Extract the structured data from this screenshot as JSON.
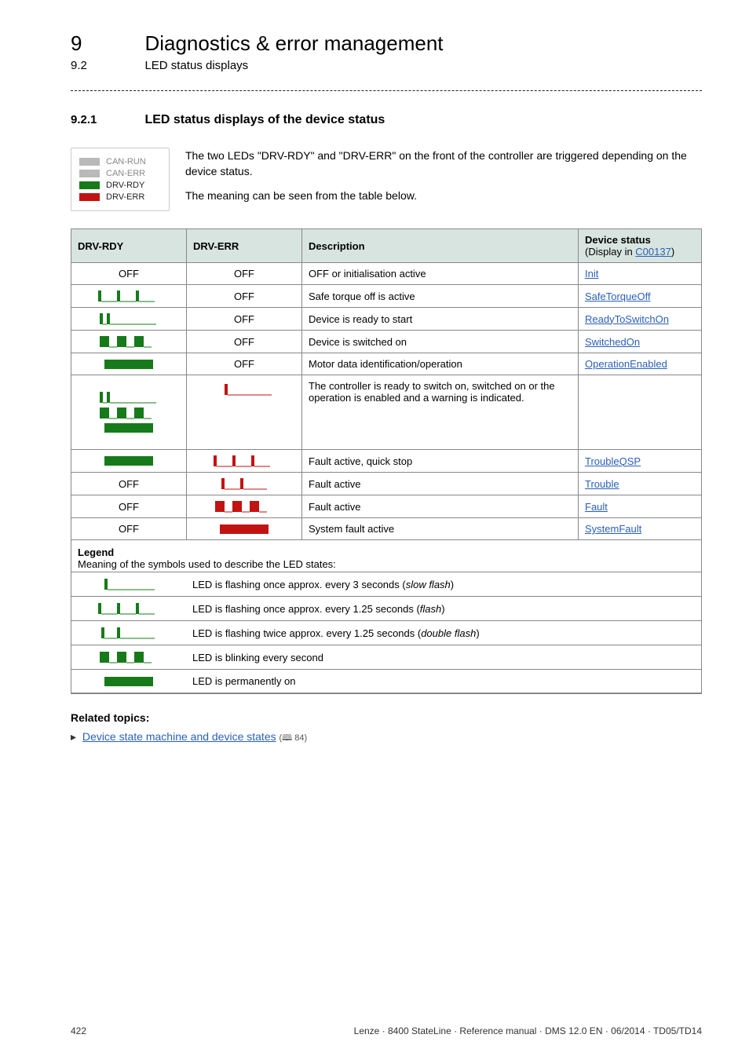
{
  "header": {
    "chapter_num": "9",
    "chapter_title": "Diagnostics & error management",
    "section_num": "9.2",
    "section_title": "LED status displays"
  },
  "sec921": {
    "num": "9.2.1",
    "title": "LED status displays of the device status"
  },
  "legend_box": {
    "items": [
      {
        "color": "grey",
        "label": "CAN-RUN"
      },
      {
        "color": "grey",
        "label": "CAN-ERR"
      },
      {
        "color": "green",
        "label": "DRV-RDY"
      },
      {
        "color": "red",
        "label": "DRV-ERR"
      }
    ]
  },
  "intro": {
    "p1": "The two LEDs \"DRV-RDY\" and \"DRV-ERR\" on the front of the controller are triggered depending on the device status.",
    "p2": "The meaning can be seen from the table below."
  },
  "table": {
    "headers": {
      "c1": "DRV-RDY",
      "c2": "DRV-ERR",
      "c3": "Description",
      "c4": "Device status",
      "c4sub": "(Display in ",
      "c4link": "C00137",
      "c4close": ")"
    },
    "rows": [
      {
        "rdy": "OFF_text",
        "err": "OFF_text",
        "desc": "OFF or initialisation active",
        "status": "Init"
      },
      {
        "rdy": "g_flash",
        "err": "OFF_text",
        "desc": "Safe torque off is active",
        "status": "SafeTorqueOff"
      },
      {
        "rdy": "g_double",
        "err": "OFF_text",
        "desc": "Device is ready to start",
        "status": "ReadyToSwitchOn"
      },
      {
        "rdy": "g_blink",
        "err": "OFF_text",
        "desc": "Device is switched on",
        "status": "SwitchedOn"
      },
      {
        "rdy": "g_on",
        "err": "OFF_text",
        "desc": "Motor data identification/operation",
        "status": "OperationEnabled"
      },
      {
        "rdy": "combo",
        "err": "r_slow",
        "desc": "The controller is ready to switch on, switched on or the operation is enabled and a warning is indicated.",
        "status": ""
      },
      {
        "rdy": "g_on",
        "err": "r_flash",
        "desc": "Fault active, quick stop",
        "status": "TroubleQSP"
      },
      {
        "rdy": "OFF_text",
        "err": "r_double",
        "desc": "Fault active",
        "status": "Trouble"
      },
      {
        "rdy": "OFF_text",
        "err": "r_blink",
        "desc": "Fault active",
        "status": "Fault"
      },
      {
        "rdy": "OFF_text",
        "err": "r_on",
        "desc": "System fault active",
        "status": "SystemFault"
      }
    ]
  },
  "legend2": {
    "title": "Legend",
    "sub": "Meaning of the symbols used to describe the LED states:",
    "rows": [
      {
        "icon": "g_slow",
        "text": "LED is flashing once approx. every 3 seconds (",
        "ital": "slow flash",
        "close": ")"
      },
      {
        "icon": "g_flash",
        "text": "LED is flashing once approx. every 1.25 seconds (",
        "ital": "flash",
        "close": ")"
      },
      {
        "icon": "g_double",
        "text": "LED is flashing twice approx. every 1.25 seconds (",
        "ital": "double flash",
        "close": ")"
      },
      {
        "icon": "g_blink",
        "text": "LED is blinking every second",
        "ital": "",
        "close": ""
      },
      {
        "icon": "g_on",
        "text": "LED is permanently on",
        "ital": "",
        "close": ""
      }
    ]
  },
  "related": {
    "heading": "Related topics:",
    "link": "Device state machine and device states",
    "page": "84"
  },
  "footer": {
    "page": "422",
    "right": "Lenze · 8400 StateLine · Reference manual · DMS 12.0 EN · 06/2014 · TD05/TD14"
  }
}
